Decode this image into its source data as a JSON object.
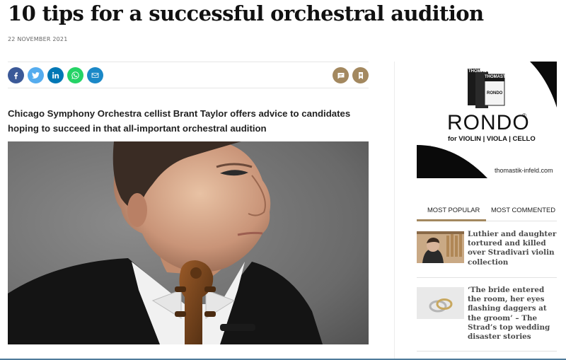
{
  "article": {
    "title": "10 tips for a successful orchestral audition",
    "date": "22 NOVEMBER 2021",
    "standfirst": "Chicago Symphony Orchestra cellist Brant Taylor offers advice to candidates hoping to succeed in that all-important orchestral audition"
  },
  "share": {
    "icons": [
      "facebook-icon",
      "twitter-icon",
      "linkedin-icon",
      "whatsapp-icon",
      "email-icon"
    ],
    "colors": {
      "facebook": "#3b5998",
      "twitter": "#55acee",
      "linkedin": "#0077b5",
      "whatsapp": "#25d366",
      "email": "#1b88c7"
    }
  },
  "tools": {
    "icons": [
      "comment-icon",
      "bookmark-icon"
    ],
    "color": "#a3885f"
  },
  "ad": {
    "box_brand_1": "THOMASTIK",
    "box_brand_2": "THOMASTIK",
    "box_label": "RONDO",
    "product": "RONDO",
    "registered": "®",
    "tagline": "for VIOLIN | VIOLA | CELLO",
    "url": "thomastik-infeld.com"
  },
  "sidebar": {
    "tabs": [
      {
        "label": "MOST POPULAR",
        "active": true
      },
      {
        "label": "MOST COMMENTED",
        "active": false
      }
    ],
    "articles": [
      {
        "title": "Luthier and daughter tortured and killed over Stradivari violin collection"
      },
      {
        "title": "‘The bride entered the room, her eyes flashing daggers at the groom’ – The Strad’s top wedding disaster stories"
      }
    ]
  },
  "colors": {
    "accent": "#a3885f",
    "headline": "#111111",
    "sidebar_title": "#4a4a4a"
  }
}
